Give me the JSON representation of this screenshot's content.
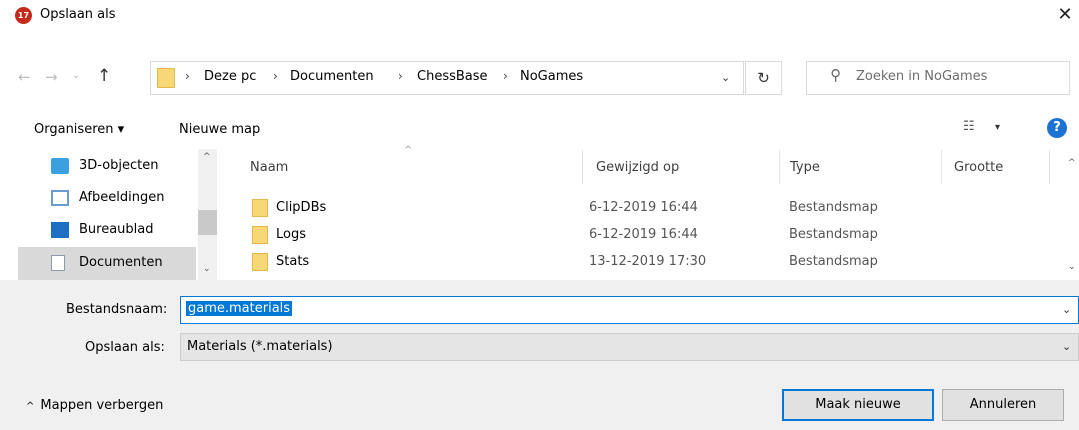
{
  "window": {
    "icon_text": "17",
    "title": "Opslaan als",
    "close_glyph": "✕"
  },
  "nav_buttons": {
    "back_glyph": "←",
    "forward_glyph": "→",
    "recent_glyph": "⌄",
    "up_glyph": "↑"
  },
  "address": {
    "crumbs": [
      "Deze pc",
      "Documenten",
      "ChessBase",
      "NoGames"
    ],
    "separator": "›",
    "dropdown_glyph": "⌄",
    "refresh_glyph": "↻"
  },
  "search": {
    "placeholder": "Zoeken in NoGames",
    "icon_glyph": "⚲"
  },
  "toolbar": {
    "organise_label": "Organiseren ▾",
    "new_folder_label": "Nieuwe map",
    "view_glyph": "☷",
    "view_drop_glyph": "▾",
    "help_glyph": "?"
  },
  "nav_pane": {
    "items": [
      {
        "label": "3D-objecten",
        "icon": "3d-objects-icon",
        "color": "#3aa0e0"
      },
      {
        "label": "Afbeeldingen",
        "icon": "pictures-icon",
        "color": "#6b9bd2"
      },
      {
        "label": "Bureaublad",
        "icon": "desktop-icon",
        "color": "#1e6fc4"
      },
      {
        "label": "Documenten",
        "icon": "documents-icon",
        "color": "#8e9aab",
        "selected": true
      }
    ],
    "scroll_up_glyph": "^",
    "scroll_down_glyph": "⌄"
  },
  "file_list": {
    "sort_glyph": "^",
    "columns": [
      "Naam",
      "Gewijzigd op",
      "Type",
      "Grootte"
    ],
    "rows": [
      {
        "name": "ClipDBs",
        "date": "6-12-2019 16:44",
        "type": "Bestandsmap"
      },
      {
        "name": "Logs",
        "date": "6-12-2019 16:44",
        "type": "Bestandsmap"
      },
      {
        "name": "Stats",
        "date": "13-12-2019 17:30",
        "type": "Bestandsmap"
      }
    ],
    "scroll_up_glyph": "^",
    "scroll_down_glyph": "⌄"
  },
  "form": {
    "filename_label": "Bestandsnaam:",
    "filename_value": "game.materials",
    "savetype_label": "Opslaan als:",
    "savetype_value": "Materials (*.materials)",
    "dropdown_glyph": "⌄"
  },
  "footer": {
    "hide_folders_label": "Mappen verbergen",
    "hide_folders_glyph": "^",
    "save_label": "Maak nieuwe",
    "cancel_label": "Annuleren"
  },
  "colors": {
    "accent": "#0078d7",
    "help": "#1c73d3",
    "app_icon": "#c42b1c",
    "folder": "#f8d776"
  }
}
